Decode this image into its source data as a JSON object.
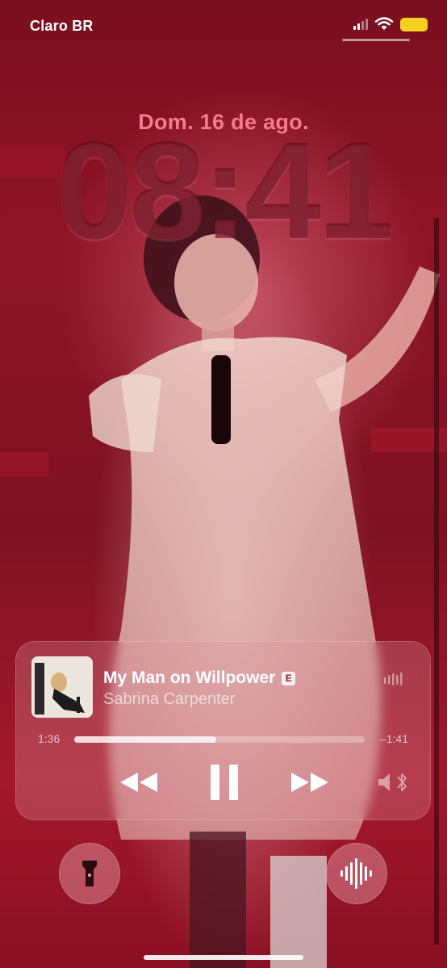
{
  "status_bar": {
    "carrier": "Claro BR",
    "signal_bars_active": 2,
    "signal_bars_total": 4,
    "battery_color": "#f5d020"
  },
  "lock_screen": {
    "date": "Dom. 16 de ago.",
    "time": "08:41",
    "date_color": "#f67a8a"
  },
  "now_playing": {
    "title": "My Man on Willpower",
    "explicit_badge": "E",
    "artist": "Sabrina Carpenter",
    "elapsed": "1:36",
    "remaining": "–1:41",
    "progress_fraction": 0.49,
    "controls": {
      "rewind_icon": "rewind-icon",
      "pause_icon": "pause-icon",
      "forward_icon": "fast-forward-icon",
      "output_icon": "speaker-bluetooth-icon"
    }
  },
  "quick_actions": {
    "left_icon": "flashlight-icon",
    "right_icon": "shazam-waveform-icon"
  }
}
